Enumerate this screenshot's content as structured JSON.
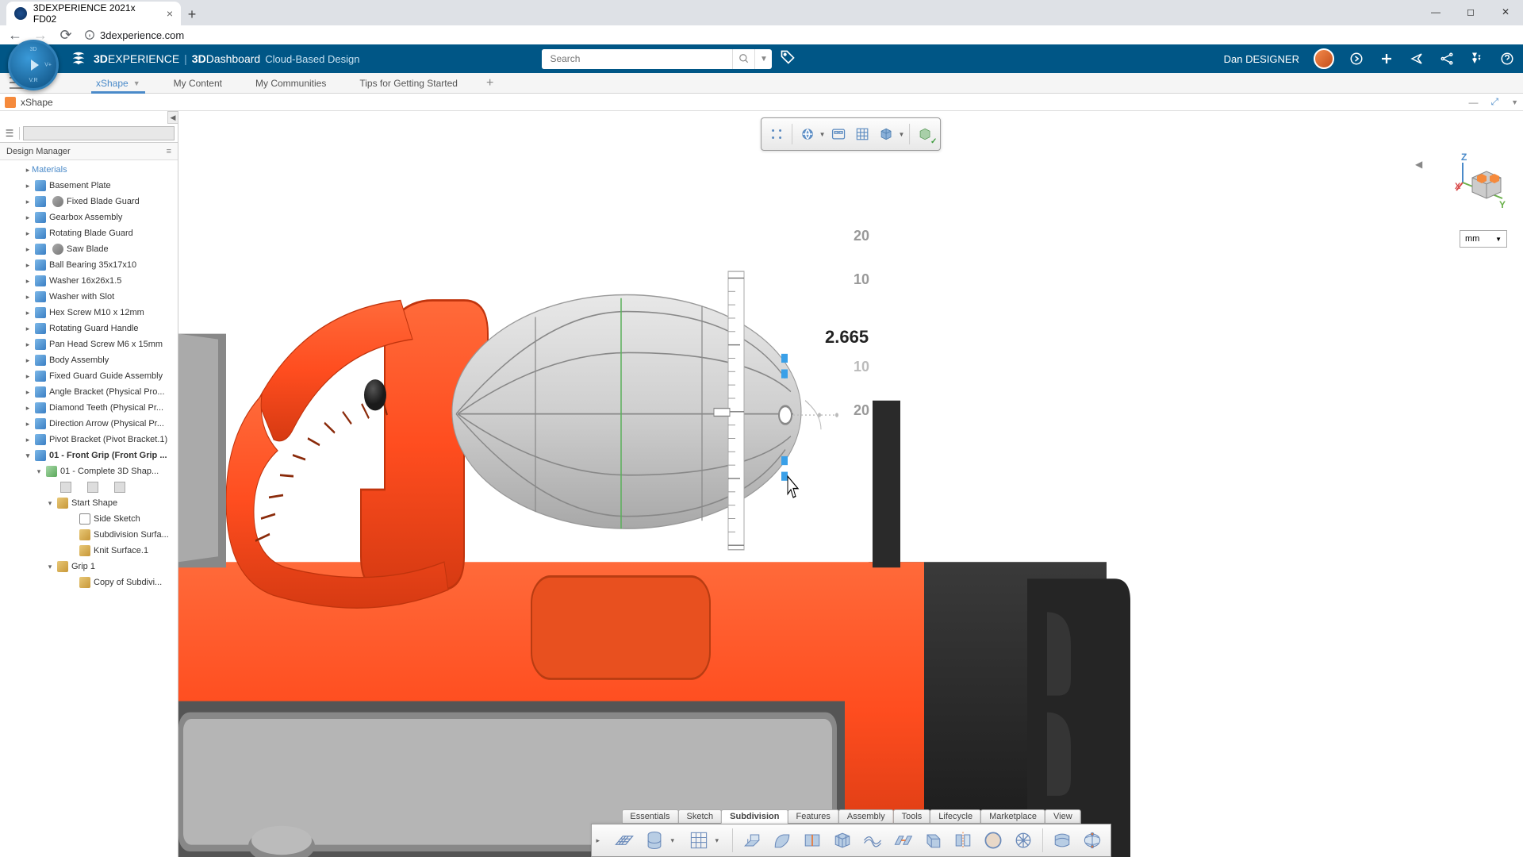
{
  "browser": {
    "tab_title": "3DEXPERIENCE 2021x FD02",
    "url": "3dexperience.com"
  },
  "header": {
    "brand_prefix": "3D",
    "brand_suffix": "EXPERIENCE",
    "dashboard_prefix": "3D",
    "dashboard_suffix": "Dashboard",
    "subtitle": "Cloud-Based Design",
    "search_placeholder": "Search",
    "user_name": "Dan DESIGNER",
    "compass": {
      "n": "3D",
      "e": "V+",
      "s": "V.R",
      "w": ""
    }
  },
  "nav_tabs": [
    "xShape",
    "My Content",
    "My Communities",
    "Tips for Getting Started"
  ],
  "app": {
    "title": "xShape"
  },
  "panel": {
    "title": "Design Manager",
    "materials_label": "Materials",
    "items": [
      "Basement Plate",
      "Fixed Blade Guard",
      "Gearbox Assembly",
      "Rotating Blade Guard",
      "Saw Blade",
      "Ball Bearing 35x17x10",
      "Washer 16x26x1.5",
      "Washer with Slot",
      "Hex Screw M10 x 12mm",
      "Rotating Guard Handle",
      "Pan Head Screw M6 x 15mm",
      "Body Assembly",
      "Fixed Guard Guide Assembly",
      "Angle Bracket (Physical Pro...",
      "Diamond Teeth (Physical Pr...",
      "Direction Arrow (Physical Pr...",
      "Pivot Bracket (Pivot Bracket.1)"
    ],
    "front_grip": "01 - Front Grip (Front Grip ...",
    "complete_shape": "01 - Complete 3D Shap...",
    "start_shape": "Start Shape",
    "side_sketch": "Side Sketch",
    "subdiv_surf": "Subdivision Surfa...",
    "knit_surf": "Knit Surface.1",
    "grip1": "Grip 1",
    "copy_subdiv": "Copy of Subdivi..."
  },
  "viewport": {
    "dimension_value": "2.665",
    "ruler_top1": "20",
    "ruler_top2": "10",
    "ruler_bot1": "10",
    "ruler_bot2": "20",
    "unit": "mm",
    "axes": {
      "z": "Z",
      "x": "X",
      "y": "Y"
    }
  },
  "feature_tabs": [
    "Essentials",
    "Sketch",
    "Subdivision",
    "Features",
    "Assembly",
    "Tools",
    "Lifecycle",
    "Marketplace",
    "View"
  ],
  "active_feature_tab": "Subdivision"
}
